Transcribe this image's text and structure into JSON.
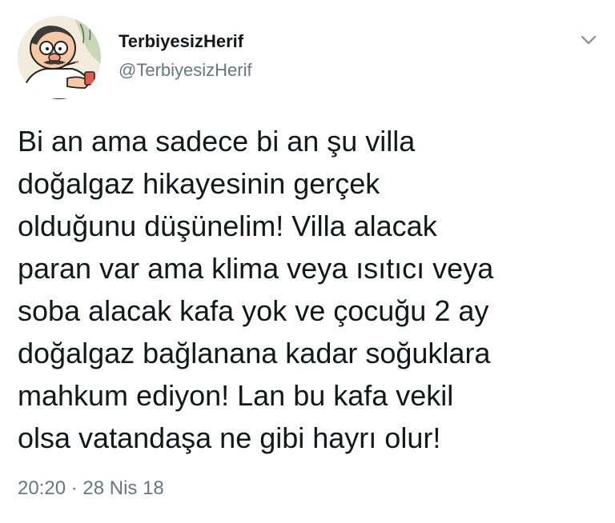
{
  "user": {
    "display_name": "TerbiyesizHerif",
    "handle": "@TerbiyesizHerif",
    "avatar_icon": "cartoon-man-avatar"
  },
  "menu": {
    "icon": "chevron-down-icon"
  },
  "tweet": {
    "lines": [
      "Bi an ama sadece bi an şu villa",
      "doğalgaz hikayesinin gerçek",
      "olduğunu düşünelim! Villa alacak",
      "paran var ama klima veya ısıtıcı veya",
      "soba alacak kafa yok ve çocuğu 2 ay",
      "doğalgaz bağlanana kadar soğuklara",
      "mahkum ediyon! Lan bu kafa vekil",
      "olsa vatandaşa ne gibi hayrı olur!"
    ],
    "timestamp": "20:20 · 28 Nis 18"
  },
  "colors": {
    "text": "#14171a",
    "secondary": "#657786",
    "background": "#ffffff"
  }
}
